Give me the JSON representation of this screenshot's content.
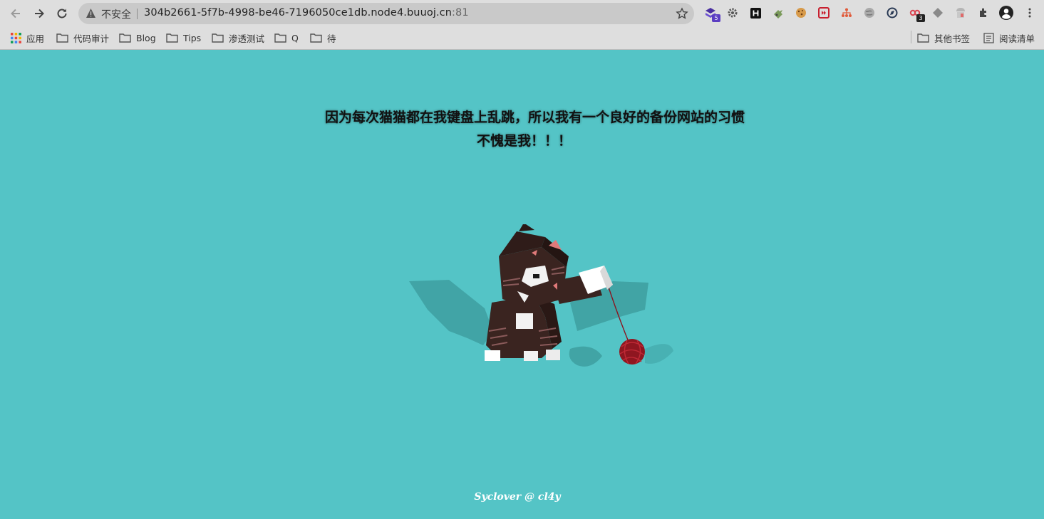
{
  "browser": {
    "address": {
      "security_label": "不安全",
      "url_host": "304b2661-5f7b-4998-be46-7196050ce1db.node4.buuoj.cn",
      "url_port": ":81"
    },
    "extensions": [
      {
        "icon": "stack-icon",
        "badge": "5",
        "badge_color": "#5b3ec2"
      },
      {
        "icon": "gear-icon"
      },
      {
        "icon": "h-icon"
      },
      {
        "icon": "puzzle-green-icon"
      },
      {
        "icon": "cookie-icon"
      },
      {
        "icon": "forward-red-icon"
      },
      {
        "icon": "tree-icon"
      },
      {
        "icon": "globe-icon"
      },
      {
        "icon": "compass-icon"
      },
      {
        "icon": "link-icon",
        "badge": "3",
        "badge_color": "#222222"
      },
      {
        "icon": "diamond-icon"
      },
      {
        "icon": "shop-icon"
      },
      {
        "icon": "extensions-icon"
      },
      {
        "icon": "profile-icon"
      },
      {
        "icon": "menu-icon"
      }
    ]
  },
  "bookmarks": {
    "apps_label": "应用",
    "items": [
      "代码审计",
      "Blog",
      "Tips",
      "渗透测试",
      "Q",
      "待"
    ],
    "other_label": "其他书签",
    "reading_list_label": "阅读清单"
  },
  "page": {
    "line1": "因为每次猫猫都在我键盘上乱跳，所以我有一个良好的备份网站的习惯",
    "line2": "不愧是我！！！",
    "footer": "Syclover @ cl4y"
  },
  "colors": {
    "background": "#54c4c6",
    "cat_body": "#3a2420",
    "yarn": "#9c1a22"
  }
}
